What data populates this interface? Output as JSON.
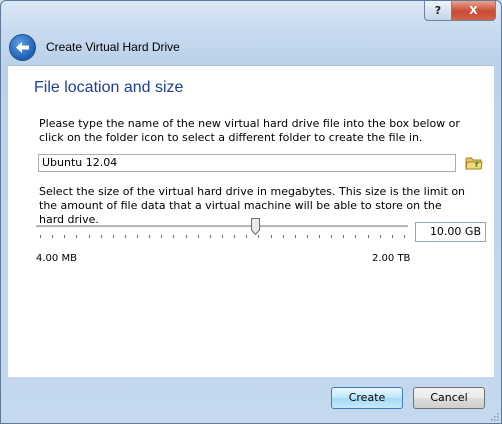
{
  "window": {
    "help_label": "?",
    "close_label": "X",
    "title": "Create Virtual Hard Drive"
  },
  "page": {
    "heading": "File location and size",
    "location_description": "Please type the name of the new virtual hard drive file into the box below or click on the folder icon to select a different folder to create the file in.",
    "file_name": "Ubuntu 12.04",
    "size_description": "Select the size of the virtual hard drive in megabytes. This size is the limit on the amount of file data that a virtual machine will be able to store on the hard drive.",
    "size_value": "10.00 GB",
    "slider_position": 0.59,
    "range_min_label": "4.00 MB",
    "range_max_label": "2.00 TB"
  },
  "buttons": {
    "create": "Create",
    "cancel": "Cancel"
  },
  "colors": {
    "heading": "#1e3f99",
    "accent": "#3c7fb1"
  },
  "icons": {
    "back": "back-arrow-icon",
    "folder": "folder-icon",
    "help": "help-icon",
    "close": "close-icon"
  }
}
